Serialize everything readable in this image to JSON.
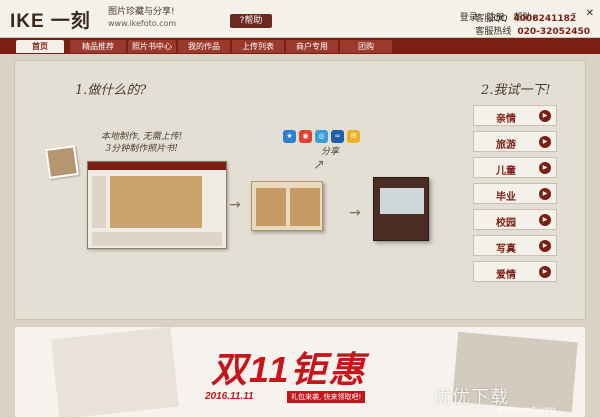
{
  "header": {
    "logo_latin": "IKE",
    "logo_cn": "一刻",
    "slogan": "图片珍藏与分享!",
    "url": "www.ikefoto.com",
    "help": "?帮助",
    "links": {
      "login": "登录",
      "register": "注册",
      "help_menu": "帮助"
    },
    "service_qq_label": "客服QQ",
    "service_qq": "4008241182",
    "hotline_label": "客服热线",
    "hotline": "020-32052450"
  },
  "nav": [
    "首页",
    "精品推荐",
    "照片书中心",
    "我的作品",
    "上传列表",
    "商户专用",
    "团购"
  ],
  "main": {
    "step1": "1.做什么的?",
    "step2": "2.我试一下!",
    "hint_line1": "本地制作, 无需上传!",
    "hint_line2": "3分钟制作照片书!",
    "share": "分享"
  },
  "categories": [
    "亲情",
    "旅游",
    "儿童",
    "毕业",
    "校园",
    "写真",
    "爱情"
  ],
  "banner": {
    "promo": "双11钜惠",
    "date": "2016.11.11",
    "tag": "礼包来袭, 快来领取吧!",
    "watermark": "优优下载",
    "watermark_url": "www.yyxt.com"
  },
  "colors": {
    "brand": "#7a1f14",
    "promo": "#c4161c"
  }
}
